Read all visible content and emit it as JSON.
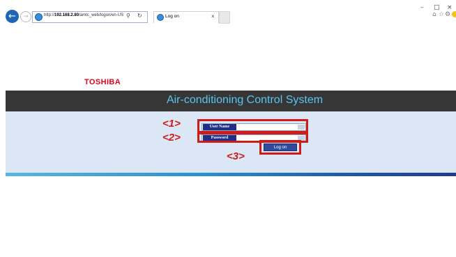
{
  "browser": {
    "url_prefix": "http://",
    "url_host": "192.168.2.80",
    "url_path": "/amtc_web/logon/en-US",
    "tab_title": "Log on",
    "tab_close": "×",
    "back_icon": "←",
    "forward_icon": "→",
    "search_icon": "⚲",
    "refresh_icon": "↻",
    "win_minimize": "–",
    "win_maximize": "□",
    "win_close": "×",
    "home_icon": "⌂",
    "favorites_icon": "☆",
    "settings_icon": "⚙"
  },
  "page": {
    "logo": "TOSHIBA",
    "title": "Air-conditioning Control System",
    "username_label": "User Name",
    "password_label": "Password",
    "logon_button": "Log on"
  },
  "annotations": {
    "marker1": "<1>",
    "marker2": "<2>",
    "marker3": "<3>"
  },
  "colors": {
    "logo": "#e0001b",
    "title_bar": "#363636",
    "title_text": "#5cc4ee",
    "panel": "#dbe7f4",
    "field_label_bg": "#1f2e86",
    "button_bg": "#2f4c9c",
    "highlight": "#d01b1b"
  }
}
